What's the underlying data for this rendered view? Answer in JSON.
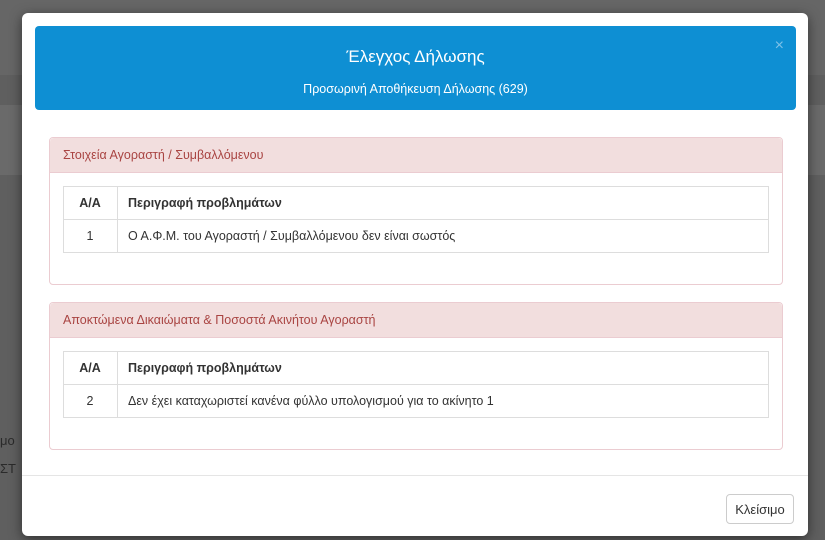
{
  "modal": {
    "title": "Έλεγχος Δήλωσης",
    "subtitle": "Προσωρινή Αποθήκευση Δήλωσης (629)",
    "close_icon": "×",
    "close_button": "Κλείσιμο"
  },
  "panels": [
    {
      "heading": "Στοιχεία Αγοραστή / Συμβαλλόμενου",
      "columns": [
        "Α/Α",
        "Περιγραφή προβλημάτων"
      ],
      "rows": [
        {
          "aa": "1",
          "description": "Ο Α.Φ.Μ. του Αγοραστή / Συμβαλλόμενου δεν είναι σωστός"
        }
      ]
    },
    {
      "heading": "Αποκτώμενα Δικαιώματα & Ποσοστά Ακινήτου Αγοραστή",
      "columns": [
        "Α/Α",
        "Περιγραφή προβλημάτων"
      ],
      "rows": [
        {
          "aa": "2",
          "description": "Δεν έχει καταχωριστεί κανένα φύλλο υπολογισμού για το ακίνητο 1"
        }
      ]
    }
  ],
  "background": {
    "fragment_1": "μο",
    "fragment_2": "ΣΤ"
  },
  "colors": {
    "header_bg": "#0e8fd3",
    "panel_heading_bg": "#f2dede",
    "panel_heading_text": "#a94442"
  }
}
